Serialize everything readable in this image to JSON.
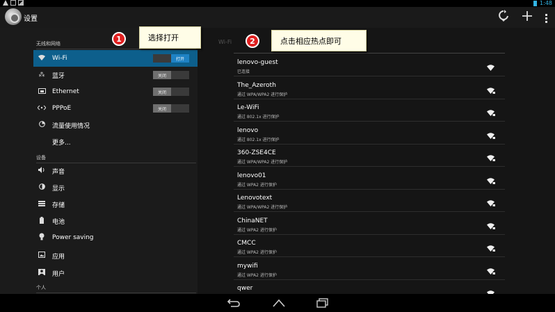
{
  "statusbar": {
    "time": "1:48"
  },
  "app": {
    "title": "设置"
  },
  "toolbar": {
    "icons": [
      "refresh-wifi-icon",
      "add-icon",
      "overflow-menu-icon"
    ]
  },
  "sidebar": {
    "sections": [
      {
        "label": "无线和网络"
      },
      {
        "label": "设备"
      },
      {
        "label": "个人"
      }
    ],
    "items": [
      {
        "label": "Wi-Fi",
        "icon": "wifi-icon",
        "toggle": "打开",
        "on": true
      },
      {
        "label": "蓝牙",
        "icon": "bluetooth-icon",
        "toggle": "关闭",
        "on": false
      },
      {
        "label": "Ethernet",
        "icon": "ethernet-icon",
        "toggle": "关闭",
        "on": false
      },
      {
        "label": "PPPoE",
        "icon": "pppoe-icon",
        "toggle": "关闭",
        "on": false
      },
      {
        "label": "流量使用情况",
        "icon": "data-usage-icon"
      },
      {
        "label": "更多..."
      },
      {
        "label": "声音",
        "icon": "sound-icon"
      },
      {
        "label": "显示",
        "icon": "display-icon"
      },
      {
        "label": "存储",
        "icon": "storage-icon"
      },
      {
        "label": "电池",
        "icon": "battery-icon"
      },
      {
        "label": "Power saving",
        "icon": "power-saving-icon"
      },
      {
        "label": "应用",
        "icon": "apps-icon"
      },
      {
        "label": "用户",
        "icon": "user-icon"
      }
    ]
  },
  "wifi": {
    "header": "Wi-Fi",
    "networks": [
      {
        "ssid": "lenovo-guest",
        "status": "已连接",
        "locked": false
      },
      {
        "ssid": "The_Azeroth",
        "status": "通过 WPA/WPA2 进行保护",
        "locked": true
      },
      {
        "ssid": "Le-WiFi",
        "status": "通过 802.1x 进行保护",
        "locked": true
      },
      {
        "ssid": "lenovo",
        "status": "通过 802.1x 进行保护",
        "locked": true
      },
      {
        "ssid": "360-ZSE4CE",
        "status": "通过 WPA/WPA2 进行保护",
        "locked": true
      },
      {
        "ssid": "lenovo01",
        "status": "通过 WPA2 进行保护",
        "locked": true
      },
      {
        "ssid": "Lenovotext",
        "status": "通过 WPA/WPA2 进行保护",
        "locked": true
      },
      {
        "ssid": "ChinaNET",
        "status": "通过 WPA2 进行保护",
        "locked": true
      },
      {
        "ssid": "CMCC",
        "status": "通过 WPA2 进行保护",
        "locked": true
      },
      {
        "ssid": "mywifi",
        "status": "通过 WPA2 进行保护",
        "locked": true
      },
      {
        "ssid": "qwer",
        "status": "",
        "locked": true
      }
    ]
  },
  "annotations": [
    {
      "number": "1",
      "text": "选择打开"
    },
    {
      "number": "2",
      "text": "点击相应热点即可"
    }
  ],
  "navbar": {
    "buttons": [
      "back-icon",
      "home-icon",
      "recent-apps-icon"
    ]
  },
  "colors": {
    "accent": "#33b5e5",
    "selected": "#0d5f8c",
    "callout_bg": "#fffde7",
    "badge": "#e02020"
  }
}
